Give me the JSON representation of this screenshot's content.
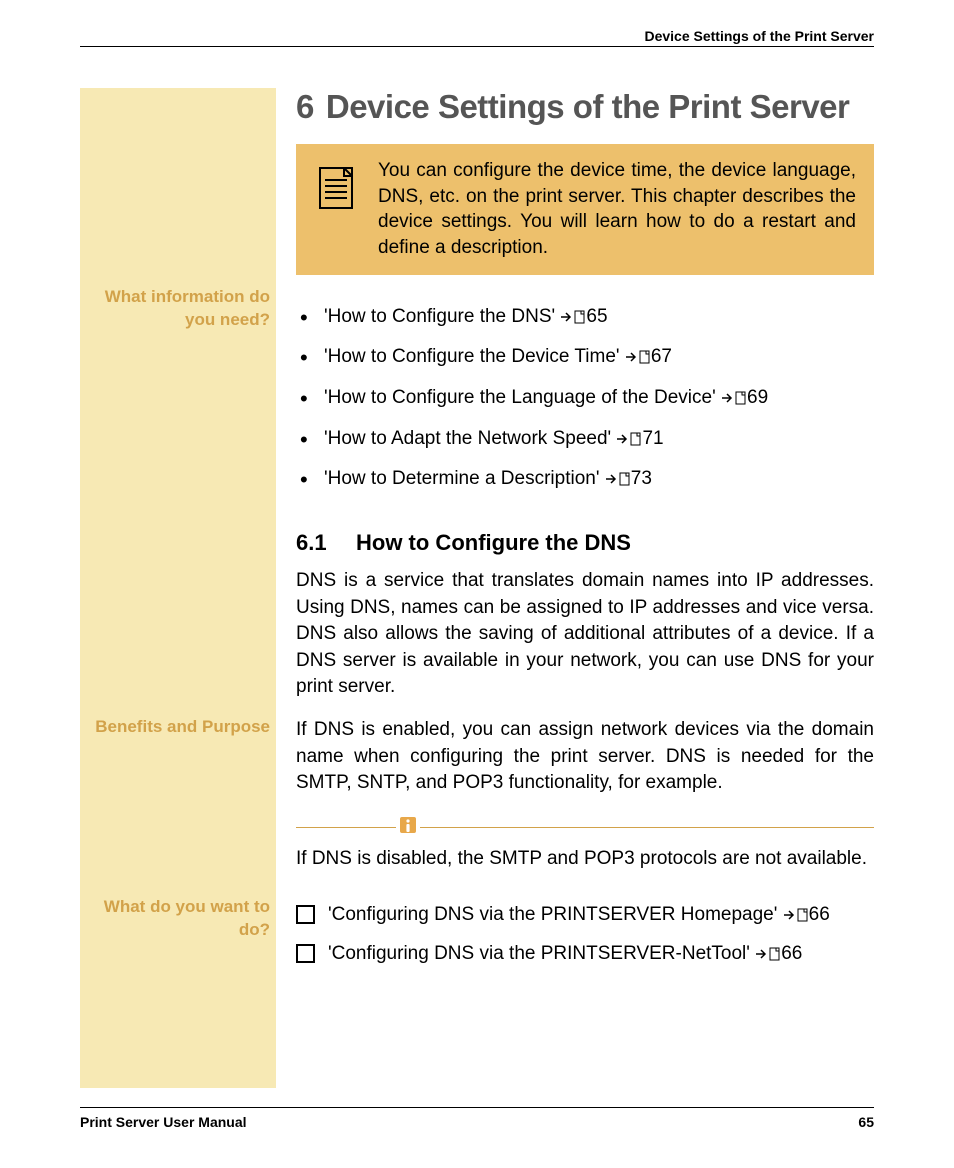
{
  "header": {
    "running_title": "Device Settings of the Print Server"
  },
  "chapter": {
    "number": "6",
    "title": "Device Settings of the Print Server"
  },
  "intro": "You can configure the device time, the device language, DNS, etc. on the print server. This chapter describes the device settings. You will learn how to do a restart and define a description.",
  "margin": {
    "info_needed": "What information do you need?",
    "benefits": "Benefits and Purpose",
    "what_do": "What do you want to do?"
  },
  "topics": [
    {
      "text": "'How to Configure the DNS'",
      "page": "65"
    },
    {
      "text": "'How to Configure the Device Time'",
      "page": "67"
    },
    {
      "text": "'How to Configure the Language of the Device'",
      "page": "69"
    },
    {
      "text": "'How to Adapt the Network Speed'",
      "page": "71"
    },
    {
      "text": "'How to Determine a Description'",
      "page": "73"
    }
  ],
  "section": {
    "number": "6.1",
    "title": "How to Configure the DNS",
    "p1": "DNS is a service that translates domain names into IP addresses. Using DNS, names can be assigned to IP addresses and vice versa. DNS also allows the saving of additional attributes of a device. If a DNS server is available in your network, you can use DNS for your print server.",
    "p2": "If DNS is enabled, you can assign network devices via the domain name when configuring the print server. DNS is needed for the SMTP, SNTP, and POP3 functionality, for example.",
    "note": "If DNS is disabled, the SMTP and POP3 protocols are not available."
  },
  "tasks": [
    {
      "text": "'Configuring DNS via the PRINTSERVER Homepage'",
      "page": "66"
    },
    {
      "text": "'Configuring DNS via the PRINTSERVER-NetTool'",
      "page": "66"
    }
  ],
  "footer": {
    "manual": "Print Server User Manual",
    "page": "65"
  }
}
